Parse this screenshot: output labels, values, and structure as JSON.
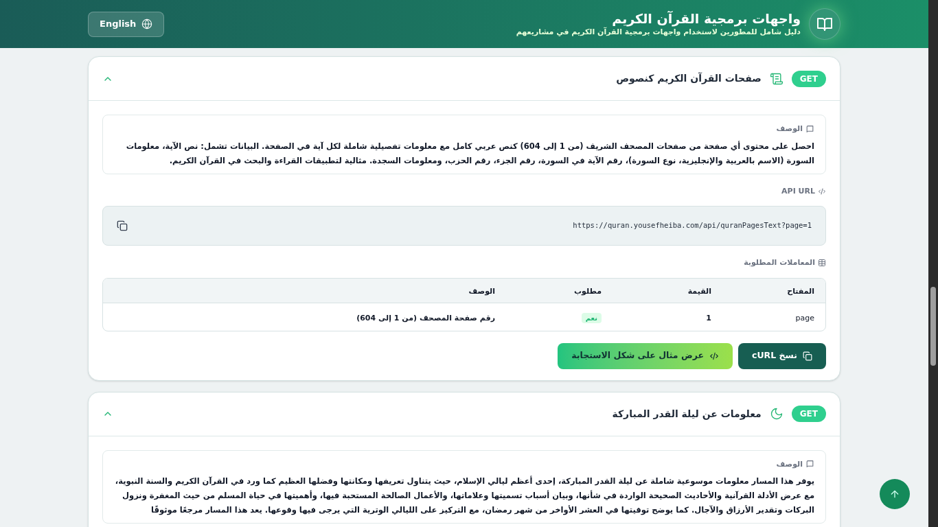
{
  "header": {
    "title": "واجهات برمجية القرآن الكريم",
    "subtitle": "دليل شامل للمطورين لاستخدام واجهات برمجية القرآن الكريم في مشاريعهم",
    "language_button": "English"
  },
  "endpoints": [
    {
      "method": "GET",
      "kind": "scroll",
      "title": "صفحات القرآن الكريم كنصوص",
      "expanded": true,
      "description_label": "الوصف",
      "description": "احصل على محتوى أي صفحة من صفحات المصحف الشريف (من 1 إلى 604) كنص عربي كامل مع معلومات تفصيلية شاملة لكل آية في الصفحة. البيانات تشمل: نص الآية، معلومات السورة (الاسم بالعربية والإنجليزية، نوع السورة)، رقم الآية في السورة، رقم الجزء، رقم الحزب، ومعلومات السجدة. مثالية لتطبيقات القراءة والبحث في القرآن الكريم.",
      "api_url_label": "API URL",
      "api_url": "https://quran.yousefheiba.com/api/quranPagesText?page=1",
      "params_label": "المعاملات المطلوبة",
      "columns": [
        "المفتاح",
        "القيمة",
        "مطلوب",
        "الوصف"
      ],
      "rows": [
        {
          "key": "page",
          "value": "1",
          "required": "نعم",
          "description": "رقم صفحة المصحف (من 1 إلى 604)"
        }
      ],
      "buttons": [
        {
          "kind": "copy",
          "label": "نسخ cURL"
        },
        {
          "kind": "code",
          "label": "عرض مثال على شكل الاستجابة"
        }
      ]
    },
    {
      "method": "GET",
      "kind": "moon",
      "title": "معلومات عن ليلة القدر المباركة",
      "expanded": true,
      "description_label": "الوصف",
      "description": "يوفر هذا المسار معلومات موسوعية شاملة عن ليلة القدر المباركة، إحدى أعظم ليالي الإسلام، حيث يتناول تعريفها ومكانتها وفضلها العظيم كما ورد في القرآن الكريم والسنة النبوية، مع عرض الأدلة القرآنية والأحاديث الصحيحة الواردة في شأنها، وبيان أسباب تسميتها وعلاماتها، والأعمال الصالحة المستحبة فيها، وأهميتها في حياة المسلم من حيث المغفرة ونزول البركات وتقدير الأرزاق والآجال. كما يوضح توقيتها في العشر الأواخر من شهر رمضان، مع التركيز على الليالي الوترية التي يرجى فيها وقوعها. يعد هذا المسار مرجعًا موثوقًا"
    }
  ]
}
